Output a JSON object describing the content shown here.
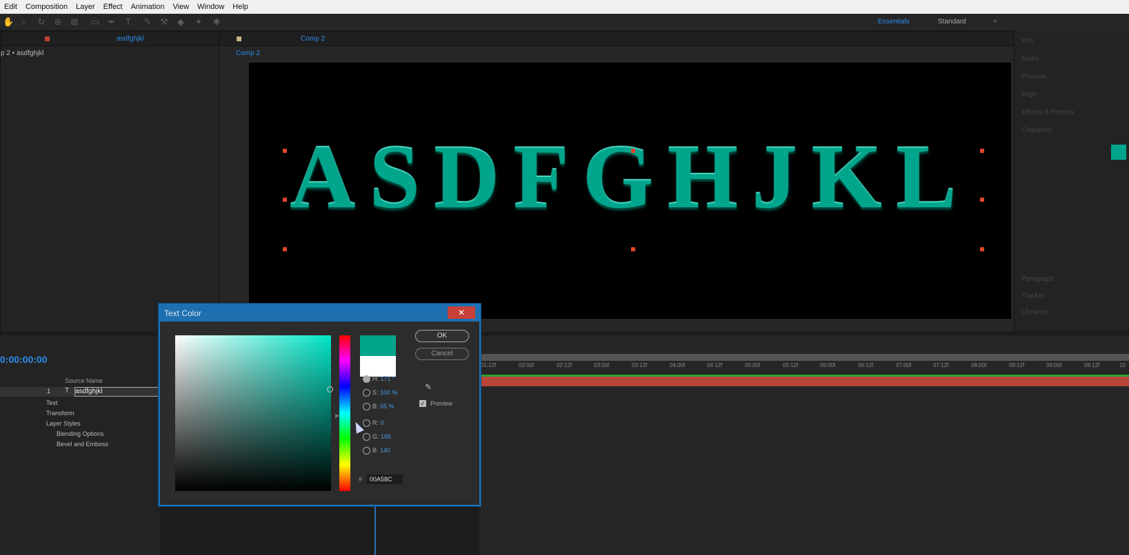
{
  "menu": [
    "Edit",
    "Composition",
    "Layer",
    "Effect",
    "Animation",
    "View",
    "Window",
    "Help"
  ],
  "workspace": {
    "active": "Essentials",
    "other": "Standard",
    "more": "»"
  },
  "project_panel": {
    "tab_label": "asdfghjkl",
    "breadcrumb": "p 2 • asdfghjkl"
  },
  "comp_panel": {
    "tab_label": "Comp 2",
    "subtab": "Comp 2"
  },
  "canvas": {
    "text": "ASDFGHJKL",
    "text_color": "#00A58C"
  },
  "right_panel": {
    "items": [
      "Info",
      "Audio",
      "Preview",
      "Align",
      "Effects & Presets",
      "Character",
      "Paragraph",
      "Tracker",
      "Libraries"
    ]
  },
  "timeline": {
    "timecode": "0:00:00:00",
    "column_header": "Source Name",
    "layer": {
      "index": "1",
      "name": "asdfghjkl"
    },
    "properties": [
      "Text",
      "Transform",
      "Layer Styles",
      "Blending Options",
      "Bevel and Emboss"
    ],
    "ticks": [
      "01:12f",
      "02:00f",
      "02:12f",
      "03:00f",
      "03:12f",
      "04:00f",
      "04:12f",
      "05:00f",
      "05:12f",
      "06:00f",
      "06:12f",
      "07:00f",
      "07:12f",
      "08:00f",
      "08:12f",
      "09:00f",
      "09:12f",
      "10"
    ]
  },
  "dialog": {
    "title": "Text Color",
    "close_glyph": "✕",
    "ok_label": "OK",
    "cancel_label": "Cancel",
    "preview_label": "Preview",
    "fields": {
      "H": {
        "label": "H:",
        "value": "171 °"
      },
      "S": {
        "label": "S:",
        "value": "100 %"
      },
      "B": {
        "label": "B:",
        "value": "65 %"
      },
      "R": {
        "label": "R:",
        "value": "0"
      },
      "G": {
        "label": "G:",
        "value": "165"
      },
      "Bl": {
        "label": "B:",
        "value": "140"
      }
    },
    "hex_label": "#",
    "hex_value": "00A58C",
    "new_color": "#00A58C",
    "old_color": "#FFFFFF"
  }
}
